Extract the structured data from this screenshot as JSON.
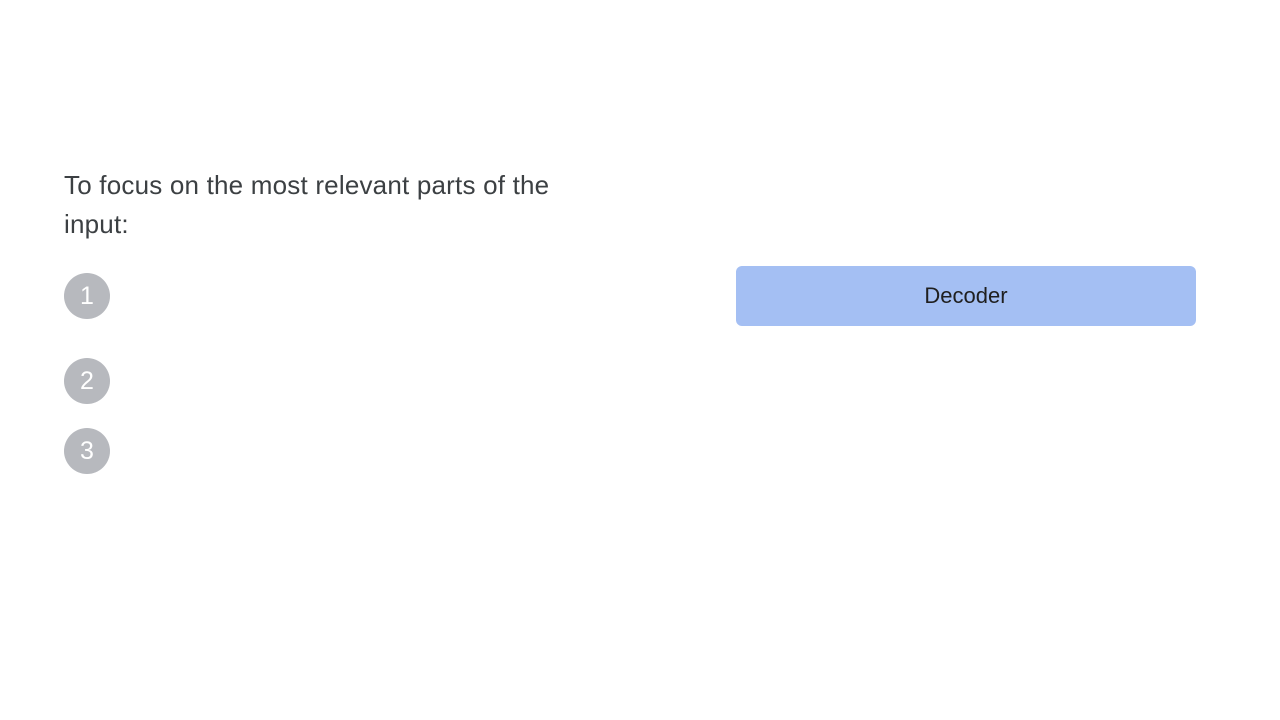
{
  "heading": "To focus on the most relevant parts of the input:",
  "steps": [
    {
      "number": "1"
    },
    {
      "number": "2"
    },
    {
      "number": "3"
    }
  ],
  "decoder": {
    "label": "Decoder",
    "color": "#a4bff3"
  },
  "colors": {
    "badge": "#b7b9be",
    "text": "#3c4043"
  }
}
